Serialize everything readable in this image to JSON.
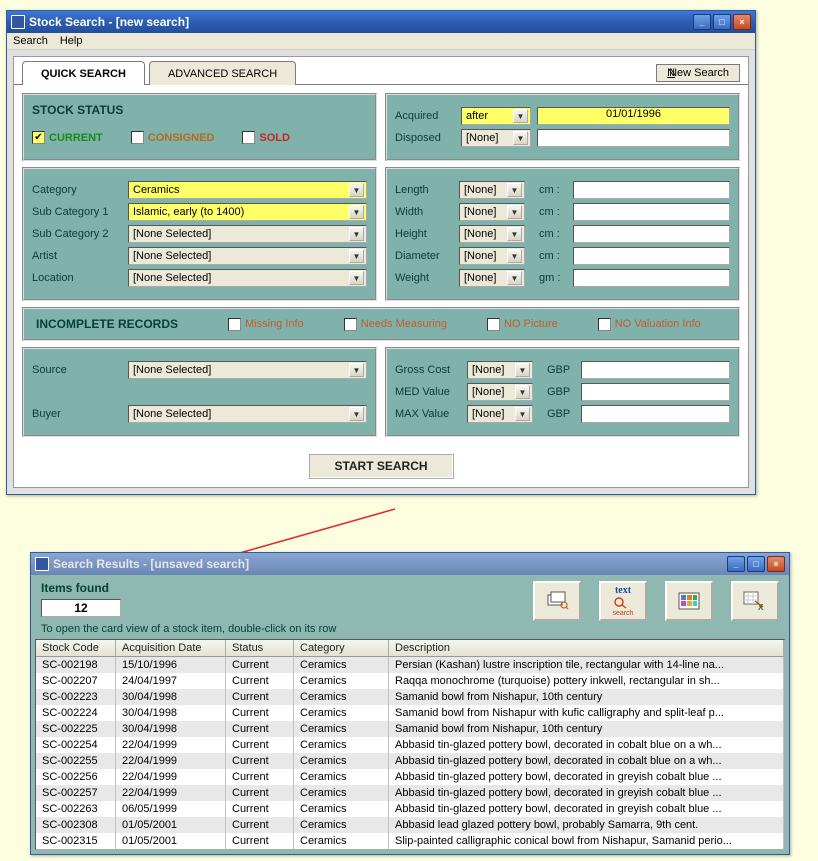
{
  "search_window": {
    "title": "Stock Search - [new search]",
    "menu": {
      "search": "Search",
      "help": "Help"
    },
    "tabs": {
      "quick": "QUICK SEARCH",
      "advanced": "ADVANCED SEARCH"
    },
    "new_search_label": "New Search",
    "status": {
      "section_label": "STOCK STATUS",
      "current": "CURRENT",
      "consigned": "CONSIGNED",
      "sold": "SOLD"
    },
    "acquired": {
      "label": "Acquired",
      "mode": "after",
      "date": "01/01/1996"
    },
    "disposed": {
      "label": "Disposed",
      "mode": "[None]",
      "date": ""
    },
    "category": {
      "label": "Category",
      "value": "Ceramics"
    },
    "subcat1": {
      "label": "Sub Category 1",
      "value": "Islamic, early (to 1400)"
    },
    "subcat2": {
      "label": "Sub Category 2",
      "value": "[None Selected]"
    },
    "artist": {
      "label": "Artist",
      "value": "[None Selected]"
    },
    "location": {
      "label": "Location",
      "value": "[None Selected]"
    },
    "dims": {
      "length": {
        "label": "Length",
        "mode": "[None]",
        "unit": "cm :"
      },
      "width": {
        "label": "Width",
        "mode": "[None]",
        "unit": "cm :"
      },
      "height": {
        "label": "Height",
        "mode": "[None]",
        "unit": "cm :"
      },
      "diameter": {
        "label": "Diameter",
        "mode": "[None]",
        "unit": "cm :"
      },
      "weight": {
        "label": "Weight",
        "mode": "[None]",
        "unit": "gm :"
      }
    },
    "incomplete": {
      "section_label": "INCOMPLETE RECORDS",
      "missing": "Missing Info",
      "measuring": "Needs Measuring",
      "nopic": "NO Picture",
      "noval": "NO Valuation Info"
    },
    "source": {
      "label": "Source",
      "value": "[None Selected]"
    },
    "buyer": {
      "label": "Buyer",
      "value": "[None Selected]"
    },
    "money": {
      "gross": {
        "label": "Gross Cost",
        "mode": "[None]",
        "ccy": "GBP"
      },
      "med": {
        "label": "MED Value",
        "mode": "[None]",
        "ccy": "GBP"
      },
      "max": {
        "label": "MAX Value",
        "mode": "[None]",
        "ccy": "GBP"
      }
    },
    "start_label": "START SEARCH"
  },
  "results_window": {
    "title": "Search Results - [unsaved search]",
    "items_found_label": "Items found",
    "items_found_count": "12",
    "hint": "To open the card view of a stock item, double-click on its row",
    "headers": {
      "code": "Stock Code",
      "date": "Acquisition Date",
      "status": "Status",
      "category": "Category",
      "description": "Description"
    },
    "rows": [
      {
        "code": "SC-002198",
        "date": "15/10/1996",
        "status": "Current",
        "category": "Ceramics",
        "desc": "Persian (Kashan) lustre inscription tile, rectangular with 14-line na..."
      },
      {
        "code": "SC-002207",
        "date": "24/04/1997",
        "status": "Current",
        "category": "Ceramics",
        "desc": "Raqqa monochrome (turquoise) pottery inkwell, rectangular in sh..."
      },
      {
        "code": "SC-002223",
        "date": "30/04/1998",
        "status": "Current",
        "category": "Ceramics",
        "desc": "Samanid bowl from Nishapur, 10th century"
      },
      {
        "code": "SC-002224",
        "date": "30/04/1998",
        "status": "Current",
        "category": "Ceramics",
        "desc": "Samanid bowl from Nishapur with kufic calligraphy and split-leaf p..."
      },
      {
        "code": "SC-002225",
        "date": "30/04/1998",
        "status": "Current",
        "category": "Ceramics",
        "desc": "Samanid bowl from Nishapur, 10th century"
      },
      {
        "code": "SC-002254",
        "date": "22/04/1999",
        "status": "Current",
        "category": "Ceramics",
        "desc": "Abbasid tin-glazed pottery bowl, decorated in cobalt blue on a wh..."
      },
      {
        "code": "SC-002255",
        "date": "22/04/1999",
        "status": "Current",
        "category": "Ceramics",
        "desc": "Abbasid tin-glazed pottery bowl, decorated in cobalt blue on a wh..."
      },
      {
        "code": "SC-002256",
        "date": "22/04/1999",
        "status": "Current",
        "category": "Ceramics",
        "desc": "Abbasid tin-glazed pottery bowl, decorated in greyish cobalt blue ..."
      },
      {
        "code": "SC-002257",
        "date": "22/04/1999",
        "status": "Current",
        "category": "Ceramics",
        "desc": "Abbasid tin-glazed pottery bowl, decorated in greyish cobalt blue ..."
      },
      {
        "code": "SC-002263",
        "date": "06/05/1999",
        "status": "Current",
        "category": "Ceramics",
        "desc": "Abbasid tin-glazed pottery bowl, decorated in greyish cobalt blue ..."
      },
      {
        "code": "SC-002308",
        "date": "01/05/2001",
        "status": "Current",
        "category": "Ceramics",
        "desc": "Abbasid lead glazed pottery bowl, probably Samarra, 9th cent."
      },
      {
        "code": "SC-002315",
        "date": "01/05/2001",
        "status": "Current",
        "category": "Ceramics",
        "desc": "Slip-painted calligraphic conical bowl from Nishapur, Samanid perio..."
      }
    ]
  }
}
